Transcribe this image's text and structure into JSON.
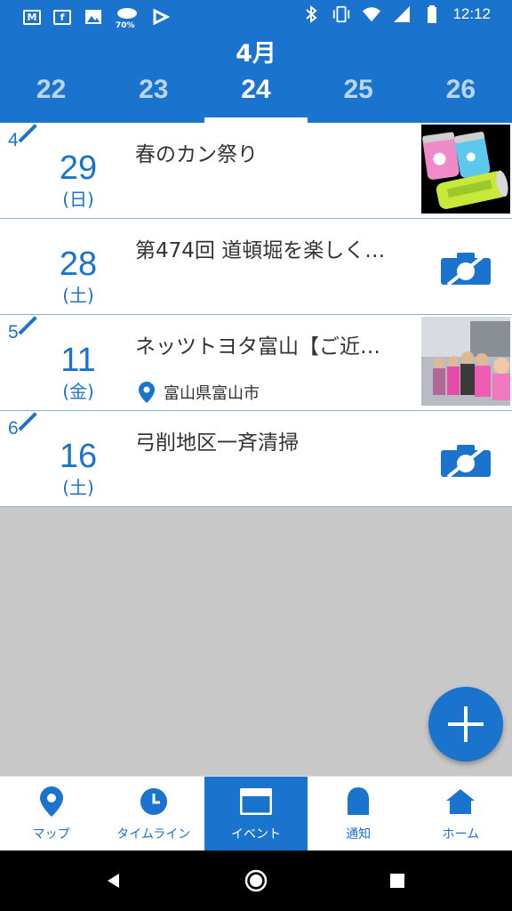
{
  "status_bar": {
    "time": "12:12",
    "weather_temp": "70%",
    "icons": [
      "gmail-icon",
      "facebook-icon",
      "photos-icon",
      "weather-icon",
      "check-app-icon",
      "bluetooth-icon",
      "vibrate-icon",
      "wifi-icon",
      "signal-icon",
      "battery-icon"
    ]
  },
  "header": {
    "month": "4月",
    "dates": [
      "22",
      "23",
      "24",
      "25",
      "26"
    ],
    "active_date": "24"
  },
  "events": [
    {
      "month": "4",
      "day": "29",
      "weekday": "(日)",
      "title": "春のカン祭り",
      "location": "",
      "media": "thumbnail-cans"
    },
    {
      "month": "",
      "day": "28",
      "weekday": "(土)",
      "title": "第474回 道頓堀を楽しく…",
      "location": "",
      "media": "no-photo"
    },
    {
      "month": "5",
      "day": "11",
      "weekday": "(金)",
      "title": "ネッツトヨタ富山【ご近…",
      "location": "富山県富山市",
      "media": "thumbnail-people"
    },
    {
      "month": "6",
      "day": "16",
      "weekday": "(土)",
      "title": "弓削地区一斉清掃",
      "location": "",
      "media": "no-photo"
    }
  ],
  "nav": {
    "items": [
      {
        "label": "マップ",
        "icon": "map-pin-icon"
      },
      {
        "label": "タイムライン",
        "icon": "clock-icon"
      },
      {
        "label": "イベント",
        "icon": "event-card-icon"
      },
      {
        "label": "通知",
        "icon": "bell-icon"
      },
      {
        "label": "ホーム",
        "icon": "home-icon"
      }
    ],
    "active": "イベント"
  },
  "colors": {
    "primary": "#1a73cc",
    "divider": "#7fb0e0",
    "background": "#c8c8c8"
  }
}
